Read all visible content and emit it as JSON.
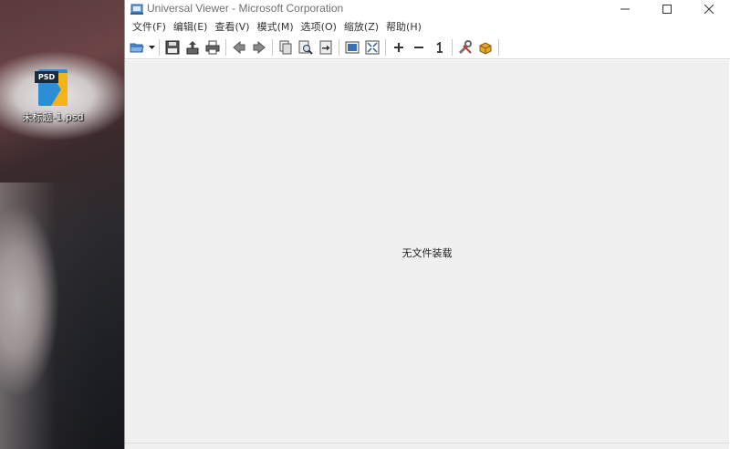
{
  "desktop": {
    "icon": {
      "badge": "PSD",
      "label": "未标题-1.psd",
      "icon_name": "psd-file-icon"
    }
  },
  "window": {
    "title": "Universal Viewer - Microsoft Corporation",
    "app_icon": "universal-viewer-icon",
    "controls": [
      "minimize-icon",
      "maximize-icon",
      "close-icon"
    ]
  },
  "menu": {
    "items": [
      "文件(F)",
      "编辑(E)",
      "查看(V)",
      "模式(M)",
      "选项(O)",
      "缩放(Z)",
      "帮助(H)"
    ]
  },
  "toolbar": {
    "buttons": [
      "open-folder-icon",
      "dropdown-arrow-icon",
      "save-icon",
      "export-icon",
      "print-icon",
      "back-arrow-icon",
      "forward-arrow-icon",
      "copy-icon",
      "find-icon",
      "goto-icon",
      "fit-image-icon",
      "fullscreen-icon",
      "zoom-in-icon",
      "zoom-out-icon",
      "original-size-icon",
      "settings-tools-icon",
      "plugins-icon"
    ]
  },
  "content": {
    "message": "无文件装载"
  },
  "colors": {
    "window_bg": "#ffffff",
    "content_bg": "#f0f0f0",
    "title_text": "#707070"
  }
}
